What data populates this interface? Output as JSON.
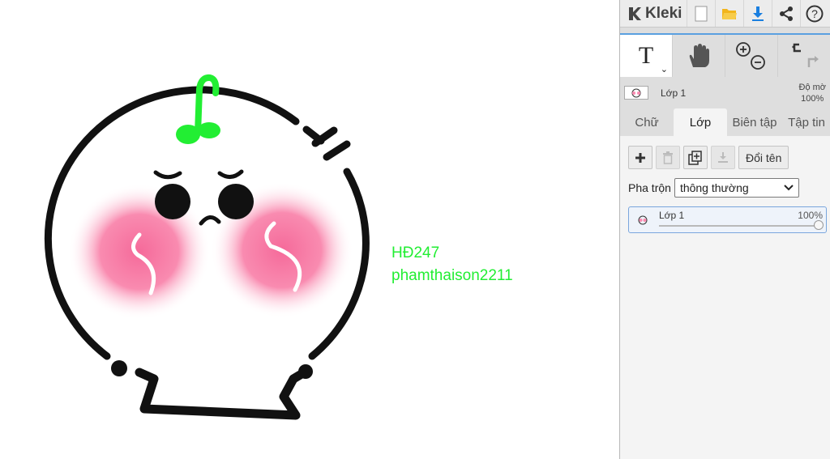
{
  "app": {
    "name": "Kleki"
  },
  "canvas": {
    "text_line1": "HĐ247",
    "text_line2": "phamthaison2211",
    "text_color": "#22ee33"
  },
  "toolbar": {
    "icons": [
      "new-image-icon",
      "open-folder-icon",
      "download-icon",
      "share-icon",
      "help-icon"
    ],
    "help_label": "?"
  },
  "tools": {
    "text_tool_label": "T",
    "items": [
      "text-tool",
      "hand-tool",
      "zoom-in-out",
      "undo-redo"
    ]
  },
  "current_layer": {
    "name": "Lớp 1",
    "opacity_label": "Độ mờ",
    "opacity_value": "100%"
  },
  "tabs": [
    {
      "label": "Chữ",
      "active": false
    },
    {
      "label": "Lớp",
      "active": true
    },
    {
      "label": "Biên tập",
      "active": false
    },
    {
      "label": "Tập tin",
      "active": false
    }
  ],
  "layer_panel": {
    "rename_label": "Đổi tên",
    "blend_label": "Pha trộn",
    "blend_value": "thông thường",
    "layers": [
      {
        "name": "Lớp 1",
        "opacity": "100%"
      }
    ]
  },
  "colors": {
    "accent": "#5aa0e0",
    "download_blue": "#1a7fe0",
    "folder_yellow": "#f2b51c",
    "sprout_green": "#22ee33",
    "blush_pink": "#f56a9a"
  }
}
